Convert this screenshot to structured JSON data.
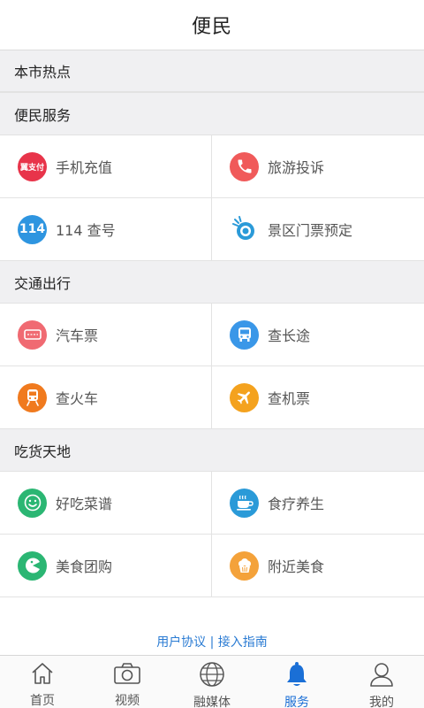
{
  "header": {
    "title": "便民"
  },
  "sections": {
    "hot": {
      "title": "本市热点"
    },
    "convenience": {
      "title": "便民服务",
      "items": [
        {
          "label": "手机充值",
          "icon": "yijiafu-icon",
          "color": "#e8344a"
        },
        {
          "label": "旅游投诉",
          "icon": "phone-icon",
          "color": "#f05a5a"
        },
        {
          "label": "114 查号",
          "icon": "114-icon",
          "color": "#2e95e0",
          "icon_text": "114"
        },
        {
          "label": "景区门票预定",
          "icon": "ticket-logo-icon",
          "color": "#2a9ad8"
        }
      ]
    },
    "transport": {
      "title": "交通出行",
      "items": [
        {
          "label": "汽车票",
          "icon": "bus-ticket-icon",
          "color": "#f06a72"
        },
        {
          "label": "查长途",
          "icon": "bus-icon",
          "color": "#3a97e8"
        },
        {
          "label": "查火车",
          "icon": "train-icon",
          "color": "#f07a1e"
        },
        {
          "label": "查机票",
          "icon": "plane-icon",
          "color": "#f4a21e"
        }
      ]
    },
    "food": {
      "title": "吃货天地",
      "items": [
        {
          "label": "好吃菜谱",
          "icon": "smile-icon",
          "color": "#2bb673"
        },
        {
          "label": "食疗养生",
          "icon": "teacup-icon",
          "color": "#2a9ad8"
        },
        {
          "label": "美食团购",
          "icon": "pacman-icon",
          "color": "#2bb673"
        },
        {
          "label": "附近美食",
          "icon": "muffin-icon",
          "color": "#f4a23a"
        }
      ]
    }
  },
  "footer": {
    "link_text": "用户协议 | 接入指南"
  },
  "tabbar": {
    "active_color": "#1a6fd6",
    "tabs": [
      {
        "label": "首页",
        "icon": "home-icon"
      },
      {
        "label": "视频",
        "icon": "camera-icon"
      },
      {
        "label": "融媒体",
        "icon": "globe-icon"
      },
      {
        "label": "服务",
        "icon": "bell-icon",
        "active": true
      },
      {
        "label": "我的",
        "icon": "user-icon"
      }
    ]
  }
}
